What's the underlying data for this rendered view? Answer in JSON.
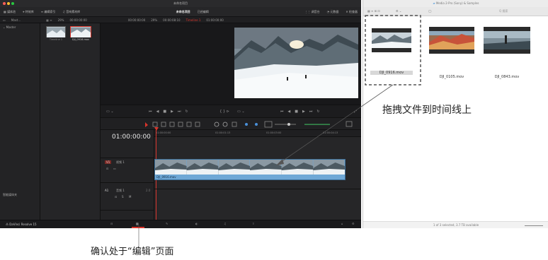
{
  "colors": {
    "resolve_bg": "#1e1e20",
    "accent_red": "#d9342b",
    "clip_blue": "#6fa8d6",
    "annotation_line": "#333333"
  },
  "resolve": {
    "window_title": "未命名项目",
    "toolbar": {
      "media_pool": "媒体池",
      "effects": "特效库",
      "edit_index": "编辑索引",
      "sound_library": "音响素材库",
      "project_name": "未命名项目",
      "edited_status": "已经编辑",
      "mixer": "调音台",
      "metadata": "元数据",
      "inspector": "检查器"
    },
    "subbar": {
      "bin_name": "Mast...",
      "src_zoom": "29%",
      "src_timecode": "00:00:00:00",
      "tl_timecode": "00:00:00:00",
      "pgm_zoom": "29%",
      "duration": "00:00:08:10",
      "timeline_name": "Timeline 1",
      "pgm_timecode": "01:00:00:00"
    },
    "left_panel": {
      "master_label": "Master",
      "smart_bins_label": "智能媒体夹"
    },
    "media_pool_items": [
      {
        "name": "Timeline 1"
      },
      {
        "name": "DJI_0916.mov"
      }
    ],
    "timeline": {
      "timecode": "01:00:00:00",
      "ruler_ticks": [
        "01:00:00:00",
        "01:00:01:13",
        "01:00:03:00",
        "01:00:04:13"
      ],
      "video_track_badge": "V1",
      "video_track_name": "视频 1",
      "audio_track_badge": "A1",
      "audio_track_name": "音频 1",
      "audio_channels": "2.0",
      "clip_name": "DJI_0916.mov",
      "clip_frames": 6
    },
    "footer": {
      "app_name": "DaVinci Resolve 15"
    }
  },
  "finder": {
    "title": "Media 2-Pro (Sony) & Samples",
    "search_placeholder": "Q 搜索",
    "items": [
      {
        "name": "DJI_0916.mov",
        "selected": true
      },
      {
        "name": "DJI_0105.mov",
        "selected": false
      },
      {
        "name": "DJI_0843.mov",
        "selected": false
      }
    ],
    "status": "1 of 3 selected, 3.7 TB available"
  },
  "annotations": {
    "drag_instruction": "拖拽文件到时间线上",
    "edit_page_note": "确认处于“编辑”页面"
  }
}
